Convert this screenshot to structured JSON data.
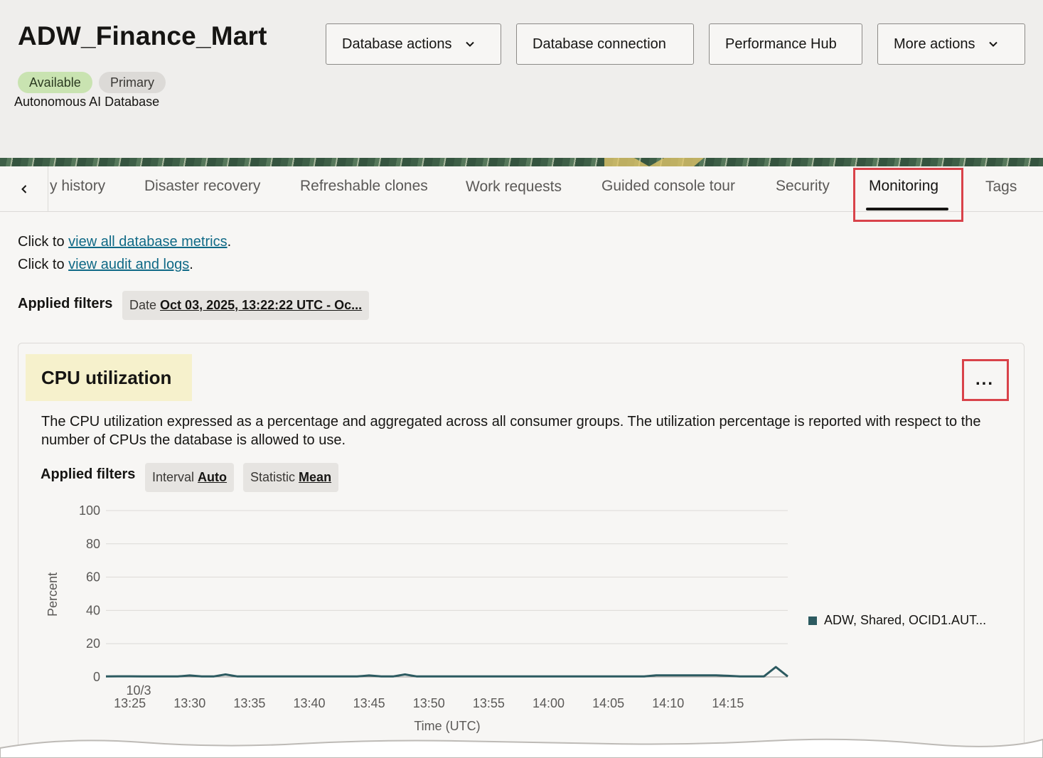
{
  "header": {
    "title": "ADW_Finance_Mart",
    "badges": {
      "status": "Available",
      "role": "Primary"
    },
    "subtitle": "Autonomous AI Database",
    "buttons": {
      "database_actions": "Database actions",
      "database_connection": "Database connection",
      "performance_hub": "Performance Hub",
      "more_actions": "More actions"
    }
  },
  "tabs": {
    "items": [
      {
        "label": "y history"
      },
      {
        "label": "Disaster recovery"
      },
      {
        "label": "Refreshable clones"
      },
      {
        "label": "Work requests"
      },
      {
        "label": "Guided console tour"
      },
      {
        "label": "Security"
      },
      {
        "label": "Monitoring"
      },
      {
        "label": "Tags"
      }
    ],
    "active": "Monitoring"
  },
  "links": {
    "prefix": "Click to",
    "metrics": "view all database metrics",
    "audit": "view audit and logs",
    "suffix": "."
  },
  "page_filters": {
    "label": "Applied filters",
    "date_key": "Date",
    "date_value": "Oct 03, 2025, 13:22:22 UTC - Oc..."
  },
  "card": {
    "title": "CPU utilization",
    "more_label": "...",
    "description": "The CPU utilization expressed as a percentage and aggregated across all consumer groups. The utilization percentage is reported with respect to the number of CPUs the database is allowed to use.",
    "filters_label": "Applied filters",
    "interval_key": "Interval",
    "interval_value": "Auto",
    "statistic_key": "Statistic",
    "statistic_value": "Mean"
  },
  "colors": {
    "accent": "#0f6986",
    "series": "#2c5a60",
    "highlight": "#d9434a"
  },
  "chart_data": {
    "type": "line",
    "title": "",
    "xlabel": "Time (UTC)",
    "ylabel": "Percent",
    "ylim": [
      0,
      100
    ],
    "yticks": [
      0,
      20,
      40,
      60,
      80,
      100
    ],
    "x_date_label": "10/3",
    "x_tick_labels": [
      "13:25",
      "13:30",
      "13:35",
      "13:40",
      "13:45",
      "13:50",
      "13:55",
      "14:00",
      "14:05",
      "14:10",
      "14:15"
    ],
    "x_tick_minutes": [
      25,
      30,
      35,
      40,
      45,
      50,
      55,
      60,
      65,
      70,
      75
    ],
    "xlim_minutes": [
      23,
      80
    ],
    "legend_position": "right",
    "series": [
      {
        "name": "ADW, Shared, OCID1.AUT...",
        "x_minutes": [
          23,
          24,
          25,
          26,
          27,
          28,
          29,
          30,
          31,
          32,
          33,
          34,
          35,
          36,
          37,
          38,
          39,
          40,
          41,
          42,
          43,
          44,
          45,
          46,
          47,
          48,
          49,
          50,
          51,
          52,
          53,
          54,
          55,
          56,
          57,
          58,
          59,
          60,
          61,
          62,
          63,
          64,
          65,
          66,
          67,
          68,
          69,
          70,
          71,
          72,
          73,
          74,
          75,
          76,
          77,
          78,
          79,
          80
        ],
        "values": [
          0.3,
          0.4,
          0.4,
          0.3,
          0.3,
          0.3,
          0.3,
          0.9,
          0.3,
          0.3,
          1.5,
          0.3,
          0.3,
          0.3,
          0.3,
          0.3,
          0.3,
          0.3,
          0.3,
          0.3,
          0.3,
          0.3,
          0.9,
          0.3,
          0.3,
          1.5,
          0.3,
          0.3,
          0.3,
          0.3,
          0.3,
          0.3,
          0.3,
          0.3,
          0.3,
          0.3,
          0.3,
          0.3,
          0.3,
          0.3,
          0.3,
          0.3,
          0.3,
          0.3,
          0.3,
          0.3,
          1.0,
          1.0,
          1.0,
          1.0,
          1.0,
          1.0,
          0.7,
          0.3,
          0.3,
          0.3,
          6.0,
          0.3
        ]
      }
    ]
  }
}
